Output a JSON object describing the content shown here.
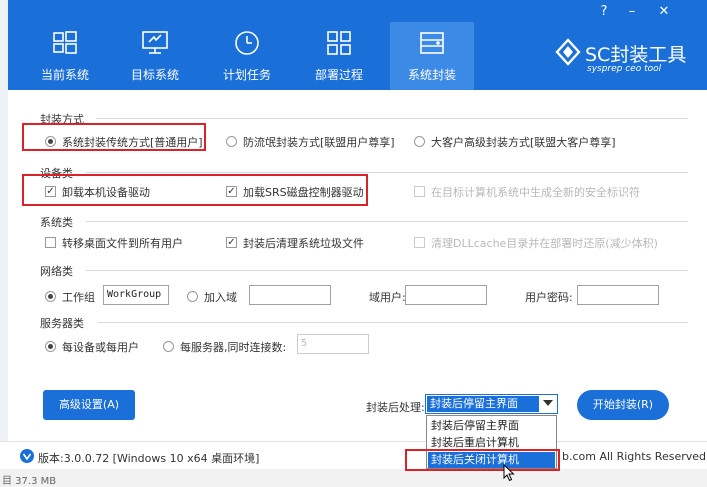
{
  "window": {
    "help_glyph": "?",
    "min_glyph": "–",
    "close_glyph": "✕"
  },
  "tabs": [
    {
      "label": "当前系统",
      "icon": "windows-icon"
    },
    {
      "label": "目标系统",
      "icon": "monitor-icon"
    },
    {
      "label": "计划任务",
      "icon": "clock-icon"
    },
    {
      "label": "部署过程",
      "icon": "grid-icon"
    },
    {
      "label": "系统封装",
      "icon": "drive-icon"
    }
  ],
  "logo": {
    "title": "SC封装工具",
    "subtitle": "sysprep ceo tool"
  },
  "sections": {
    "packaging": {
      "title": "封装方式",
      "options": [
        {
          "label": "系统封装传统方式[普通用户]",
          "selected": true
        },
        {
          "label": "防流氓封装方式[联盟用户尊享]",
          "selected": false
        },
        {
          "label": "大客户高级封装方式[联盟大客户尊享]",
          "selected": false
        }
      ]
    },
    "devices": {
      "title": "设备类",
      "options": [
        {
          "label": "卸载本机设备驱动",
          "checked": true
        },
        {
          "label": "加载SRS磁盘控制器驱动",
          "checked": true
        },
        {
          "label": "在目标计算机系统中生成全新的安全标识符",
          "checked": false
        }
      ]
    },
    "system": {
      "title": "系统类",
      "options": [
        {
          "label": "转移桌面文件到所有用户",
          "checked": false
        },
        {
          "label": "封装后清理系统垃圾文件",
          "checked": true
        },
        {
          "label": "清理DLLcache目录并在部署时还原(减少体积)",
          "checked": false
        }
      ]
    },
    "network": {
      "title": "网络类",
      "workgroup_label": "工作组",
      "workgroup_value": "WorkGroup",
      "domain_label": "加入域",
      "domain_user_label": "域用户:",
      "user_password_label": "用户密码:"
    },
    "server": {
      "title": "服务器类",
      "per_device_label": "每设备或每用户",
      "per_server_label": "每服务器,同时连接数:",
      "connections_value": "5"
    }
  },
  "actions": {
    "advanced_label": "高级设置(A)",
    "post_label": "封装后处理:",
    "post_selected": "封装后停留主界面",
    "post_options": [
      "封装后停留主界面",
      "封装后重启计算机",
      "封装后关闭计算机"
    ],
    "start_label": "开始封装(R)"
  },
  "footer": {
    "version": "版本:3.0.0.72 [Windows 10 x64 桌面环境]",
    "copyright": "b.com All Rights Reserved."
  },
  "bottom_strip": "目 37.3 MB",
  "colors": {
    "primary": "#1a6fd8",
    "active_tab": "#3b8ae6",
    "annotation": "#d8232a"
  }
}
